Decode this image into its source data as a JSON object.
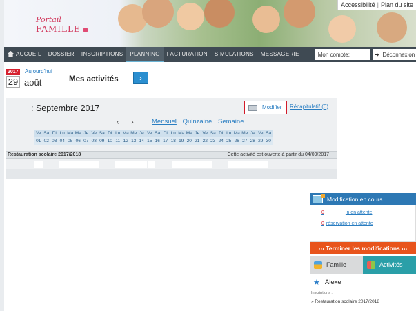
{
  "header": {
    "logo_line1": "Portail",
    "logo_line2": "FAMILLE",
    "toplinks": [
      "Accessibilité",
      "Plan du site"
    ]
  },
  "nav": {
    "items": [
      "Accueil",
      "Dossier",
      "Inscriptions",
      "Planning",
      "Facturation",
      "Simulations",
      "Messagerie"
    ],
    "active": "Planning",
    "account_label": "Mon compte:",
    "logout_label": "Déconnexion"
  },
  "date": {
    "year": "2017",
    "today_link": "Aujourd'hui",
    "day": "29",
    "month": "août"
  },
  "main": {
    "title": "Mes activités",
    "go_label": "›"
  },
  "planning": {
    "month_title": ": Septembre 2017",
    "modifier_label": "Modifier",
    "recap_label": "Récapitulatif (0)",
    "prev_label": "‹",
    "next_label": "›",
    "views": [
      "Mensuel",
      "Quinzaine",
      "Semaine"
    ],
    "weekdays": [
      "Ve",
      "Sa",
      "Di",
      "Lu",
      "Ma",
      "Me",
      "Je",
      "Ve",
      "Sa",
      "Di",
      "Lu",
      "Ma",
      "Me",
      "Je",
      "Ve",
      "Sa",
      "Di",
      "Lu",
      "Ma",
      "Me",
      "Je",
      "Ve",
      "Sa",
      "Di",
      "Lu",
      "Ma",
      "Me",
      "Je",
      "Ve",
      "Sa"
    ],
    "days": [
      "01",
      "02",
      "03",
      "04",
      "05",
      "06",
      "07",
      "08",
      "09",
      "10",
      "11",
      "12",
      "13",
      "14",
      "15",
      "16",
      "17",
      "18",
      "19",
      "20",
      "21",
      "22",
      "23",
      "24",
      "25",
      "26",
      "27",
      "28",
      "29",
      "30"
    ],
    "activity_name": "Restauration scolaire 2017/2018",
    "activity_note": "Cette activité est ouverte à partir du 04/09/2017"
  },
  "side": {
    "header": "Modification en cours",
    "line1_count": "0",
    "line1_text": "in en attente",
    "line2_count": "0",
    "line2_text": "réservation en attente",
    "terminer": "››› Terminer les modifications ‹‹‹",
    "tab_famille": "Famille",
    "tab_activites": "Activités",
    "child_name": "Alexe",
    "inscriptions_label": "Inscriptions :",
    "inscription_item": "» Restauration scolaire 2017/2018"
  },
  "colors": {
    "nav_bg": "#3f4a53",
    "link": "#2a7ec2",
    "accent_red": "#d6202e",
    "side_header": "#2d78b4",
    "terminer_bg": "#e8541c",
    "activites_tab": "#2a9fa8"
  }
}
